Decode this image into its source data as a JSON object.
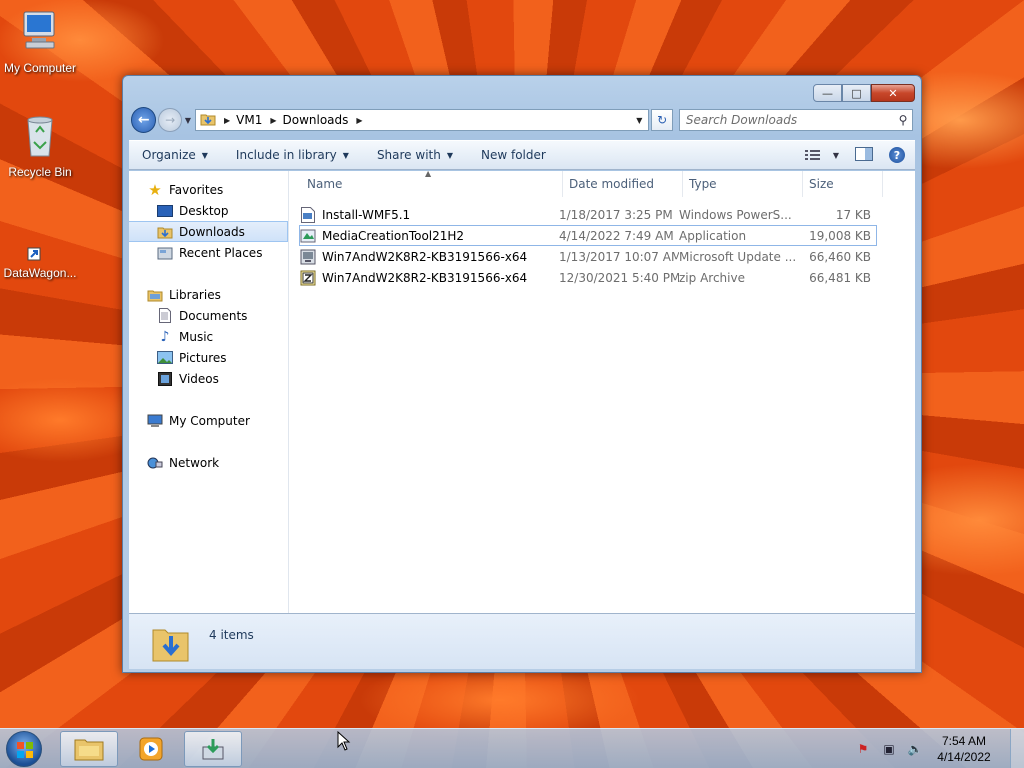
{
  "desktop": {
    "icons": [
      {
        "label": "My Computer",
        "icon": "computer-icon"
      },
      {
        "label": "Recycle Bin",
        "icon": "recycle-bin-icon"
      },
      {
        "label": "DataWagon...",
        "icon": "shortcut-icon"
      }
    ]
  },
  "window": {
    "breadcrumb": [
      "VM1",
      "Downloads"
    ],
    "search_placeholder": "Search Downloads",
    "toolbar": {
      "organize": "Organize",
      "include_in_library": "Include in library",
      "share_with": "Share with",
      "new_folder": "New folder"
    },
    "nav_pane": {
      "favorites": {
        "label": "Favorites",
        "items": [
          "Desktop",
          "Downloads",
          "Recent Places"
        ],
        "selected": "Downloads"
      },
      "libraries": {
        "label": "Libraries",
        "items": [
          "Documents",
          "Music",
          "Pictures",
          "Videos"
        ]
      },
      "computer": "My Computer",
      "network": "Network"
    },
    "columns": [
      "Name",
      "Date modified",
      "Type",
      "Size"
    ],
    "files": [
      {
        "name": "Install-WMF5.1",
        "date": "1/18/2017 3:25 PM",
        "type": "Windows PowerS...",
        "size": "17 KB",
        "icon": "powershell-script-icon"
      },
      {
        "name": "MediaCreationTool21H2",
        "date": "4/14/2022 7:49 AM",
        "type": "Application",
        "size": "19,008 KB",
        "icon": "application-icon",
        "selected": true
      },
      {
        "name": "Win7AndW2K8R2-KB3191566-x64",
        "date": "1/13/2017 10:07 AM",
        "type": "Microsoft Update ...",
        "size": "66,460 KB",
        "icon": "msu-icon"
      },
      {
        "name": "Win7AndW2K8R2-KB3191566-x64",
        "date": "12/30/2021 5:40 PM",
        "type": "zip Archive",
        "size": "66,481 KB",
        "icon": "zip-icon"
      }
    ],
    "status": "4 items"
  },
  "taskbar": {
    "time": "7:54 AM",
    "date": "4/14/2022",
    "pinned": [
      "explorer-icon",
      "media-player-icon",
      "download-app-icon"
    ]
  }
}
